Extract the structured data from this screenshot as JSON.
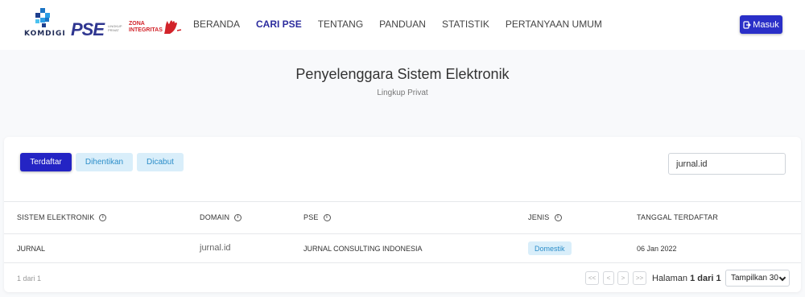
{
  "header": {
    "logo_komdigi": "KOMDIGI",
    "logo_pse": "PSE",
    "logo_pse_small": "LINGKUP PRIVAT",
    "logo_zona_1": "ZONA",
    "logo_zona_2": "INTEGRITAS",
    "nav": [
      "BERANDA",
      "CARI PSE",
      "TENTANG",
      "PANDUAN",
      "STATISTIK",
      "PERTANYAAN UMUM"
    ],
    "active_nav": "CARI PSE",
    "login_label": "Masuk"
  },
  "page": {
    "title": "Penyelenggara Sistem Elektronik",
    "subtitle": "Lingkup Privat"
  },
  "tabs": {
    "terdaftar": "Terdaftar",
    "dihentikan": "Dihentikan",
    "dicabut": "Dicabut"
  },
  "search": {
    "value": "jurnal.id"
  },
  "table": {
    "columns": [
      "SISTEM ELEKTRONIK",
      "DOMAIN",
      "PSE",
      "JENIS",
      "TANGGAL TERDAFTAR"
    ],
    "rows": [
      {
        "sistem": "JURNAL",
        "domain": "jurnal.id",
        "pse": "JURNAL CONSULTING INDONESIA",
        "jenis": "Domestik",
        "tanggal": "06 Jan 2022"
      }
    ]
  },
  "pagination": {
    "count": "1 dari 1",
    "first": "<<",
    "prev": "<",
    "next": ">",
    "last": ">>",
    "label": "Halaman",
    "page": "1 dari 1",
    "page_size": "Tampilkan 30"
  },
  "colors": {
    "primary": "#2a2fc8",
    "badge_bg": "#d9eefa",
    "badge_text": "#2c8ec9",
    "active_nav": "#2c2c9e"
  }
}
